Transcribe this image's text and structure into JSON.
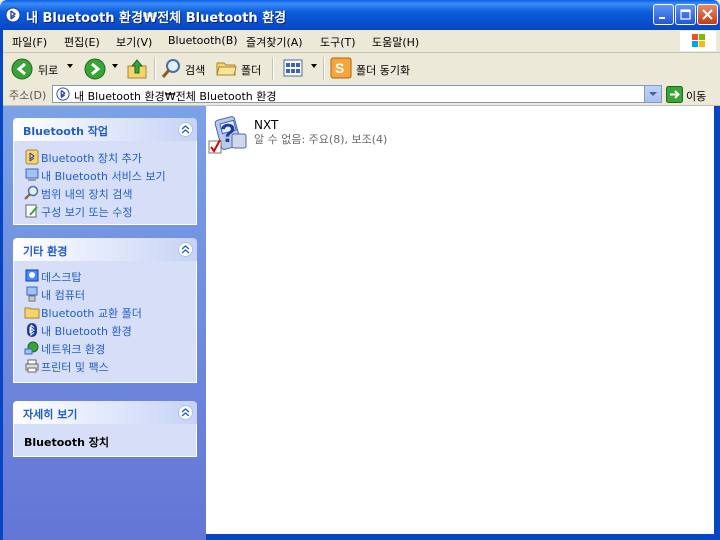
{
  "window": {
    "title": "내 Bluetooth 환경₩전체 Bluetooth 환경"
  },
  "menu": {
    "items": [
      "파일(F)",
      "편집(E)",
      "보기(V)",
      "Bluetooth(B)",
      "즐겨찾기(A)",
      "도구(T)",
      "도움말(H)"
    ]
  },
  "toolbar": {
    "back_label": "뒤로",
    "search_label": "검색",
    "folders_label": "폴더",
    "sync_label": "폴더 동기화"
  },
  "address": {
    "label": "주소(D)",
    "value": "내 Bluetooth 환경₩전체 Bluetooth 환경",
    "go_label": "이동"
  },
  "left": {
    "bt_tasks": {
      "title": "Bluetooth 작업",
      "items": [
        "Bluetooth 장치 추가",
        "내 Bluetooth 서비스 보기",
        "범위 내의 장치 검색",
        "구성 보기 또는 수정"
      ]
    },
    "other_places": {
      "title": "기타 환경",
      "items": [
        "데스크탑",
        "내 컴퓨터",
        "Bluetooth 교환 폴더",
        "내 Bluetooth 환경",
        "네트워크 환경",
        "프린터 및 팩스"
      ]
    },
    "details": {
      "title": "자세히 보기",
      "name": "Bluetooth 장치"
    }
  },
  "content": {
    "device": {
      "name": "NXT",
      "status": "알 수 없음: 주요(8), 보조(4)"
    }
  },
  "colors": {
    "titlebar": "#0a5ee8",
    "taskpane": "#7ba2e7",
    "link": "#215dc6"
  }
}
